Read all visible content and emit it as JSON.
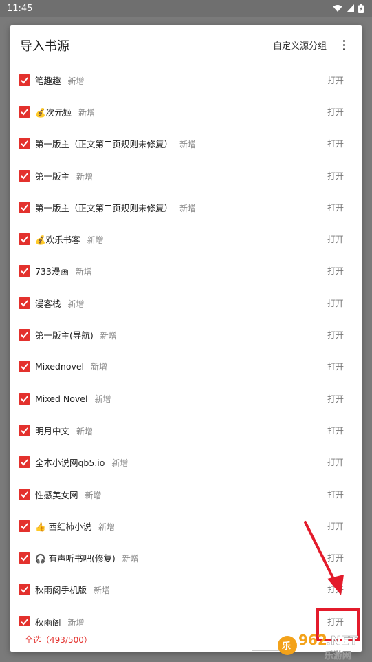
{
  "status_bar": {
    "time": "11:45"
  },
  "dialog": {
    "title": "导入书源",
    "group_button": "自定义源分组",
    "more_icon": "more-vert-icon"
  },
  "items": [
    {
      "name": "笔趣趣",
      "tag": "新增",
      "action": "打开"
    },
    {
      "name": "💰次元姬",
      "tag": "新增",
      "action": "打开"
    },
    {
      "name": "第一版主（正文第二页规则未修复）",
      "tag": "新增",
      "action": "打开"
    },
    {
      "name": "第一版主",
      "tag": "新增",
      "action": "打开"
    },
    {
      "name": "第一版主（正文第二页规则未修复）",
      "tag": "新增",
      "action": "打开"
    },
    {
      "name": "💰欢乐书客",
      "tag": "新增",
      "action": "打开"
    },
    {
      "name": "733漫画",
      "tag": "新增",
      "action": "打开"
    },
    {
      "name": "漫客栈",
      "tag": "新增",
      "action": "打开"
    },
    {
      "name": "第一版主(导航)",
      "tag": "新增",
      "action": "打开"
    },
    {
      "name": "Mixednovel",
      "tag": "新增",
      "action": "打开"
    },
    {
      "name": "Mixed Novel",
      "tag": "新增",
      "action": "打开"
    },
    {
      "name": "明月中文",
      "tag": "新增",
      "action": "打开"
    },
    {
      "name": "全本小说网qb5.io",
      "tag": "新增",
      "action": "打开"
    },
    {
      "name": "性感美女网",
      "tag": "新增",
      "action": "打开"
    },
    {
      "name": "👍 西红柿小说",
      "tag": "新增",
      "action": "打开"
    },
    {
      "name": "🎧 有声听书吧(修复)",
      "tag": "新增",
      "action": "打开"
    },
    {
      "name": "秋雨阁手机版",
      "tag": "新增",
      "action": "打开"
    },
    {
      "name": "秋雨阁",
      "tag": "新增",
      "action": "打开"
    }
  ],
  "footer": {
    "select_all": "全选（493/500）"
  },
  "watermark": {
    "text1": "962",
    "text2": ".NET",
    "text3": "乐游网"
  },
  "colors": {
    "accent": "#e3312d",
    "annotation": "#e31b2b"
  }
}
